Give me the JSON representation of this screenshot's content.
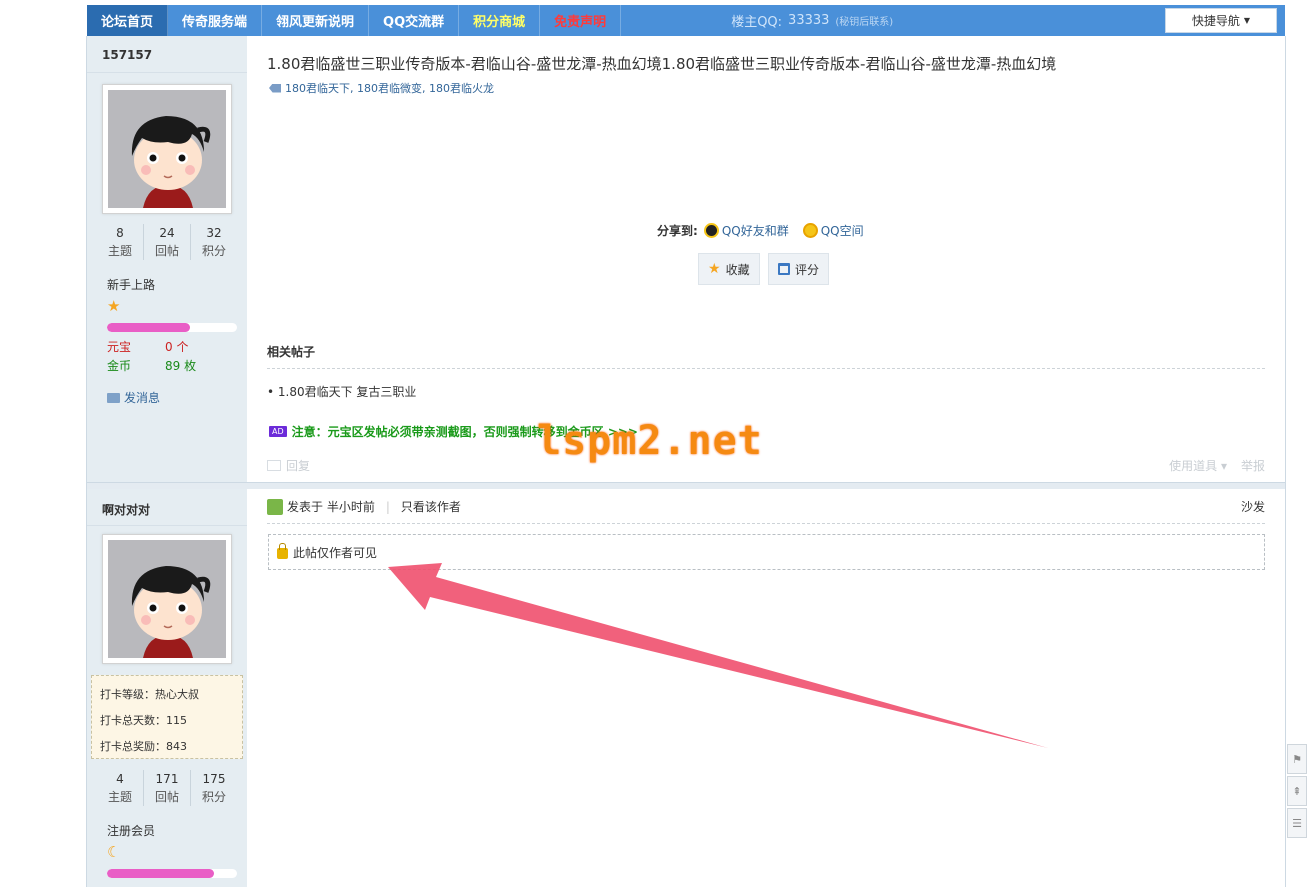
{
  "nav": {
    "items": [
      {
        "label": "论坛首页",
        "style": "active"
      },
      {
        "label": "传奇服务端",
        "style": ""
      },
      {
        "label": "翎风更新说明",
        "style": ""
      },
      {
        "label": "QQ交流群",
        "style": ""
      },
      {
        "label": "积分商城",
        "style": "yellow"
      },
      {
        "label": "免责声明",
        "style": "red"
      }
    ],
    "qq_label": "楼主QQ:",
    "qq_value": "33333",
    "qq_note": "(秘钥后联系)",
    "quicknav_label": "快捷导航",
    "colors": {
      "bar": "#4a90d9",
      "active": "#2b6cb0",
      "accent_yellow": "#ffff66",
      "accent_red": "#ff3a3a"
    }
  },
  "post1": {
    "author": {
      "name": "157157",
      "stats": [
        {
          "num": "8",
          "label": "主题"
        },
        {
          "num": "24",
          "label": "回帖"
        },
        {
          "num": "32",
          "label": "积分"
        }
      ],
      "level": "新手上路",
      "level_progress": 0.64,
      "currency1_label": "元宝",
      "currency1_value": "0 个",
      "currency2_label": "金币",
      "currency2_value": "89 枚",
      "message_label": "发消息"
    },
    "title": "1.80君临盛世三职业传奇版本-君临山谷-盛世龙潭-热血幻境1.80君临盛世三职业传奇版本-君临山谷-盛世龙潭-热血幻境",
    "tags": "180君临天下, 180君临微变, 180君临火龙",
    "share_label": "分享到:",
    "share_qq": "QQ好友和群",
    "share_qzone": "QQ空间",
    "fav_label": "收藏",
    "rate_label": "评分",
    "related_title": "相关帖子",
    "related_item": "• 1.80君临天下 复古三职业",
    "ad_badge": "AD",
    "ad_text": "注意：元宝区发帖必须带亲测截图，否则强制转移到金币区 >>>",
    "reply_label": "回复",
    "tools_label": "使用道具 ▾",
    "report_label": "举报",
    "watermark": "lspm2.net"
  },
  "post2": {
    "author": {
      "name": "啊对对对",
      "checkin_level": "打卡等级：热心大叔",
      "checkin_days": "打卡总天数：115",
      "checkin_reward": "打卡总奖励：843",
      "stats": [
        {
          "num": "4",
          "label": "主题"
        },
        {
          "num": "171",
          "label": "回帖"
        },
        {
          "num": "175",
          "label": "积分"
        }
      ],
      "level": "注册会员",
      "level_progress": 0.82
    },
    "posted_at": "发表于 半小时前",
    "only_author": "只看该作者",
    "floor": "沙发",
    "locked_text": "此帖仅作者可见"
  }
}
